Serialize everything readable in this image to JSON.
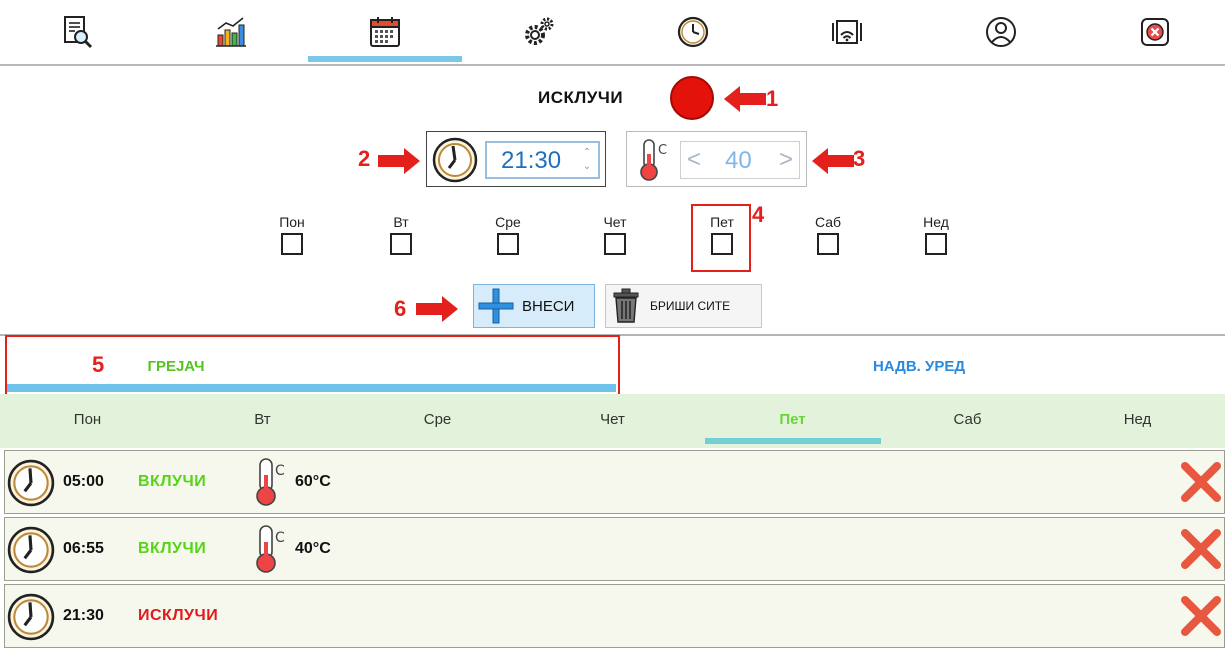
{
  "toolbar": {
    "items": [
      {
        "icon": "report-search-icon"
      },
      {
        "icon": "chart-icon"
      },
      {
        "icon": "calendar-icon"
      },
      {
        "icon": "gears-icon"
      },
      {
        "icon": "clock-icon"
      },
      {
        "icon": "remote-device-icon"
      },
      {
        "icon": "user-icon"
      },
      {
        "icon": "close-icon"
      }
    ],
    "active_index": 2
  },
  "form": {
    "status_label": "ИСКЛУЧИ",
    "status_color": "#e3130b",
    "time_value": "21:30",
    "temp_value": "40",
    "temp_prev": "<",
    "temp_next": ">",
    "days": [
      "Пон",
      "Вт",
      "Сре",
      "Чет",
      "Пет",
      "Саб",
      "Нед"
    ],
    "add_label": "ВНЕСИ",
    "delete_all_label": "БРИШИ СИТЕ"
  },
  "markers": {
    "m1": "1",
    "m2": "2",
    "m3": "3",
    "m4": "4",
    "m5": "5",
    "m6": "6"
  },
  "mode_tabs": {
    "heater": "ГРЕЈАЧ",
    "office": "НАДВ. УРЕД",
    "active": "heater"
  },
  "day_tabs": {
    "items": [
      "Пон",
      "Вт",
      "Сре",
      "Чет",
      "Пет",
      "Саб",
      "Нед"
    ],
    "active": "Пет"
  },
  "schedule": [
    {
      "time": "05:00",
      "action": "ВКЛУЧИ",
      "state": "on",
      "temp": "60°C"
    },
    {
      "time": "06:55",
      "action": "ВКЛУЧИ",
      "state": "on",
      "temp": "40°C"
    },
    {
      "time": "21:30",
      "action": "ИСКЛУЧИ",
      "state": "off",
      "temp": ""
    }
  ],
  "colors": {
    "accent_blue": "#6fc2ea",
    "on_green": "#56d418",
    "off_red": "#e11b1b",
    "marker_red": "#e3201b"
  }
}
